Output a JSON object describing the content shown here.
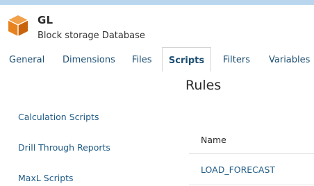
{
  "header": {
    "icon": "cube-icon",
    "title": "GL",
    "subtitle": "Block storage Database"
  },
  "tabs": [
    {
      "label": "General",
      "active": false
    },
    {
      "label": "Dimensions",
      "active": false
    },
    {
      "label": "Files",
      "active": false
    },
    {
      "label": "Scripts",
      "active": true
    },
    {
      "label": "Filters",
      "active": false
    },
    {
      "label": "Variables",
      "active": false
    }
  ],
  "main": {
    "title": "Rules",
    "side_links": [
      "Calculation Scripts",
      "Drill Through Reports",
      "MaxL Scripts"
    ],
    "table": {
      "header": "Name",
      "rows": [
        "LOAD_FORECAST"
      ]
    }
  },
  "colors": {
    "accent": "#1d4f73",
    "link": "#1f5b86",
    "icon_orange": "#e8821f",
    "top_strip": "#b9d6ee"
  }
}
